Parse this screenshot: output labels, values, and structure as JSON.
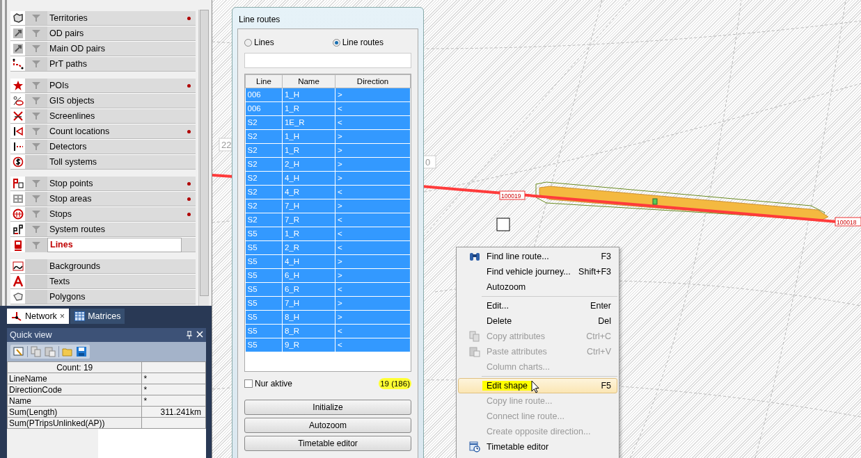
{
  "layer_panel": {
    "groups": [
      {
        "items": [
          {
            "label": "Territories",
            "filter": true,
            "dot": true,
            "selected": false
          },
          {
            "label": "OD pairs",
            "filter": true,
            "dot": false,
            "selected": false
          },
          {
            "label": "Main OD pairs",
            "filter": true,
            "dot": false,
            "selected": false
          },
          {
            "label": "PrT paths",
            "filter": true,
            "dot": false,
            "selected": false
          }
        ]
      },
      {
        "items": [
          {
            "label": "POIs",
            "filter": true,
            "dot": true,
            "selected": false
          },
          {
            "label": "GIS objects",
            "filter": true,
            "dot": false,
            "selected": false
          },
          {
            "label": "Screenlines",
            "filter": true,
            "dot": false,
            "selected": false
          },
          {
            "label": "Count locations",
            "filter": true,
            "dot": true,
            "selected": false
          },
          {
            "label": "Detectors",
            "filter": true,
            "dot": false,
            "selected": false
          },
          {
            "label": "Toll systems",
            "filter": false,
            "dot": false,
            "selected": false
          }
        ]
      },
      {
        "items": [
          {
            "label": "Stop points",
            "filter": true,
            "dot": true,
            "selected": false
          },
          {
            "label": "Stop areas",
            "filter": true,
            "dot": true,
            "selected": false
          },
          {
            "label": "Stops",
            "filter": true,
            "dot": true,
            "selected": false
          },
          {
            "label": "System routes",
            "filter": true,
            "dot": false,
            "selected": false
          },
          {
            "label": "Lines",
            "filter": true,
            "dot": false,
            "selected": true
          }
        ]
      },
      {
        "items": [
          {
            "label": "Backgrounds",
            "filter": false,
            "dot": false,
            "selected": false
          },
          {
            "label": "Texts",
            "filter": false,
            "dot": false,
            "selected": false
          },
          {
            "label": "Polygons",
            "filter": false,
            "dot": false,
            "selected": false
          }
        ]
      }
    ]
  },
  "bottom_tabs": [
    {
      "label": "Network",
      "close": "×",
      "selected": true
    },
    {
      "label": "Matrices",
      "selected": false
    }
  ],
  "quick_view": {
    "title": "Quick view",
    "header": "Count: 19",
    "rows": [
      {
        "attribute": "LineName",
        "value": "*"
      },
      {
        "attribute": "DirectionCode",
        "value": "*"
      },
      {
        "attribute": "Name",
        "value": "*"
      },
      {
        "attribute": "Sum(Length)",
        "value": "311.241km"
      },
      {
        "attribute": "Sum(PTripsUnlinked(AP))"
      }
    ]
  },
  "map": {
    "node_labels": [
      "22",
      "0"
    ],
    "link_labels": [
      "100019",
      "100018"
    ]
  },
  "dialog": {
    "title": "Line routes",
    "modes": [
      {
        "label": "Lines",
        "selected": false
      },
      {
        "label": "Line routes",
        "selected": true
      }
    ],
    "table": {
      "columns": [
        "Line",
        "Name",
        "Direction"
      ],
      "rows": [
        {
          "cells": [
            "006",
            "1_H",
            ">"
          ],
          "selected": true
        },
        {
          "cells": [
            "006",
            "1_R",
            "<"
          ],
          "selected": true
        },
        {
          "cells": [
            "S2",
            "1E_R",
            "<"
          ],
          "selected": true
        },
        {
          "cells": [
            "S2",
            "1_H",
            ">"
          ],
          "selected": true
        },
        {
          "cells": [
            "S2",
            "1_R",
            ">"
          ],
          "selected": true
        },
        {
          "cells": [
            "S2",
            "2_H",
            ">"
          ],
          "selected": true
        },
        {
          "cells": [
            "S2",
            "4_H",
            ">"
          ],
          "selected": true
        },
        {
          "cells": [
            "S2",
            "4_R",
            "<"
          ],
          "selected": true
        },
        {
          "cells": [
            "S2",
            "7_H",
            ">"
          ],
          "selected": true
        },
        {
          "cells": [
            "S2",
            "7_R",
            "<"
          ],
          "selected": true
        },
        {
          "cells": [
            "S5",
            "1_R",
            "<"
          ],
          "selected": true
        },
        {
          "cells": [
            "S5",
            "2_R",
            "<"
          ],
          "selected": true
        },
        {
          "cells": [
            "S5",
            "4_H",
            ">"
          ],
          "selected": true
        },
        {
          "cells": [
            "S5",
            "6_H",
            ">"
          ],
          "selected": true
        },
        {
          "cells": [
            "S5",
            "6_R",
            "<"
          ],
          "selected": true
        },
        {
          "cells": [
            "S5",
            "7_H",
            ">"
          ],
          "selected": true
        },
        {
          "cells": [
            "S5",
            "8_H",
            ">"
          ],
          "selected": true
        },
        {
          "cells": [
            "S5",
            "8_R",
            "<"
          ],
          "selected": true
        },
        {
          "cells": [
            "S5",
            "9_R",
            "<"
          ],
          "selected": true
        }
      ]
    },
    "only_active": {
      "label": "Nur aktive",
      "checked": false
    },
    "count": {
      "text": "19 (186)",
      "highlighted": true
    },
    "buttons": [
      "Initialize",
      "Autozoom",
      "Timetable editor"
    ]
  },
  "context_menu": {
    "items": [
      {
        "kind": "item",
        "label": "Find line route...",
        "shortcut": "F3",
        "disabled": false,
        "selected": false,
        "highlighted": false
      },
      {
        "kind": "item",
        "label": "Find vehicle journey...",
        "shortcut": "Shift+F3",
        "disabled": false,
        "selected": false,
        "highlighted": false
      },
      {
        "kind": "item",
        "label": "Autozoom",
        "disabled": false,
        "selected": false,
        "highlighted": false
      },
      {
        "kind": "separator"
      },
      {
        "kind": "item",
        "label": "Edit...",
        "shortcut": "Enter",
        "disabled": false,
        "selected": false,
        "highlighted": false
      },
      {
        "kind": "item",
        "label": "Delete",
        "shortcut": "Del",
        "disabled": false,
        "selected": false,
        "highlighted": false
      },
      {
        "kind": "item",
        "label": "Copy attributes",
        "shortcut": "Ctrl+C",
        "disabled": true,
        "selected": false,
        "highlighted": false
      },
      {
        "kind": "item",
        "label": "Paste attributes",
        "shortcut": "Ctrl+V",
        "disabled": true,
        "selected": false,
        "highlighted": false
      },
      {
        "kind": "item",
        "label": "Column charts...",
        "disabled": true,
        "selected": false,
        "highlighted": false
      },
      {
        "kind": "separator"
      },
      {
        "kind": "item",
        "label": "Edit shape",
        "shortcut": "F5",
        "disabled": false,
        "selected": true,
        "highlighted": true
      },
      {
        "kind": "item",
        "label": "Copy line route...",
        "disabled": true,
        "selected": false,
        "highlighted": false
      },
      {
        "kind": "item",
        "label": "Connect line route...",
        "disabled": true,
        "selected": false,
        "highlighted": false
      },
      {
        "kind": "item",
        "label": "Create opposite direction...",
        "disabled": true,
        "selected": false,
        "highlighted": false
      },
      {
        "kind": "item",
        "label": "Timetable editor",
        "disabled": false,
        "selected": false,
        "highlighted": false
      }
    ]
  }
}
